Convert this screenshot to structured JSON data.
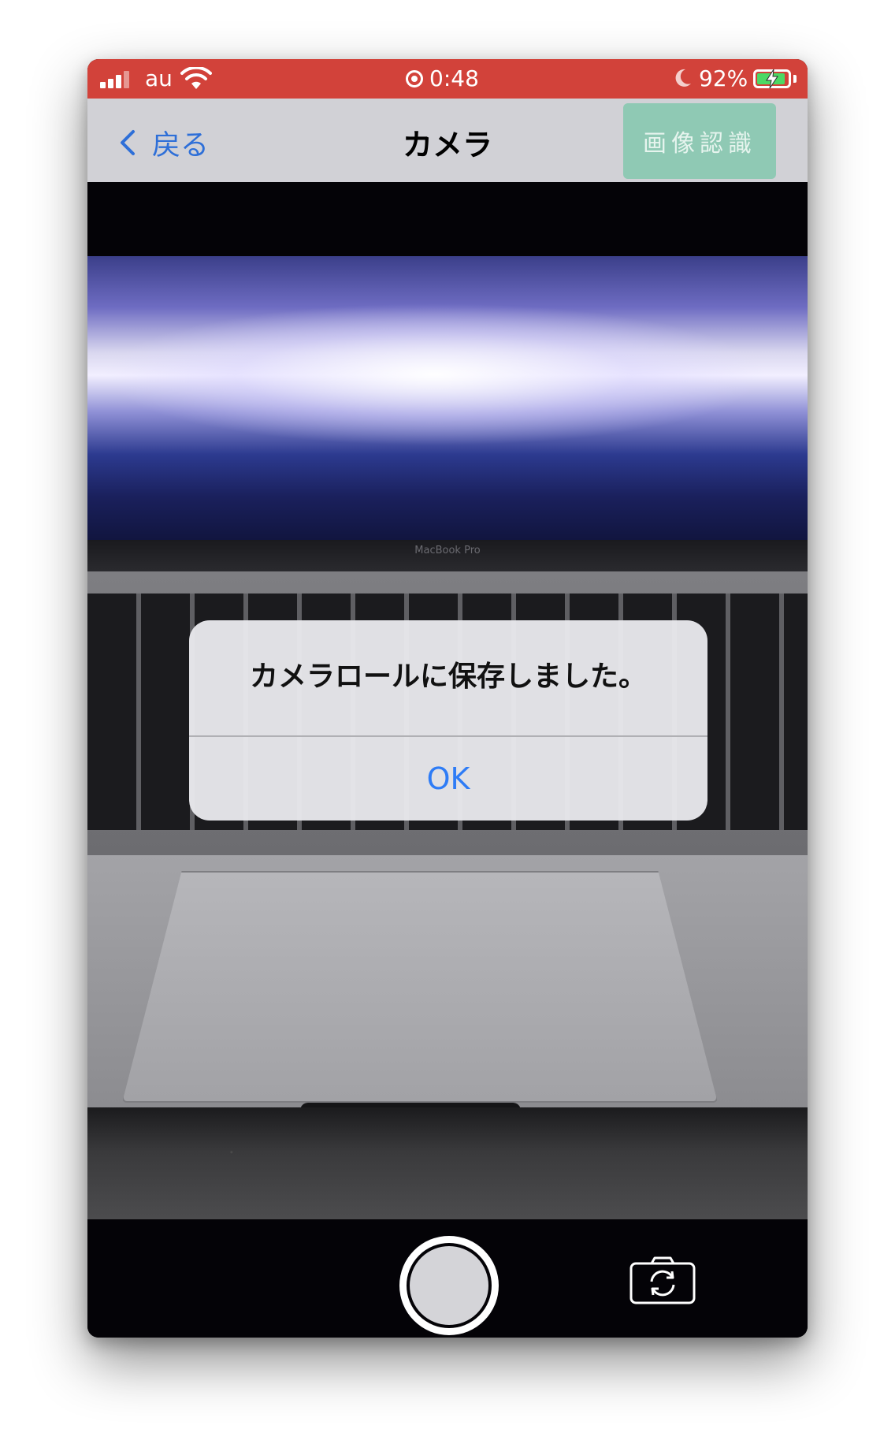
{
  "status_bar": {
    "carrier": "au",
    "time": "0:48",
    "battery_percent": "92%",
    "battery_level": 0.92,
    "background_color": "#d2423a"
  },
  "nav": {
    "back_label": "戻る",
    "title": "カメラ",
    "recognize_label": "画像認識"
  },
  "preview": {
    "bezel_label": "MacBook Pro"
  },
  "alert": {
    "message": "カメラロールに保存しました。",
    "ok_label": "OK"
  },
  "colors": {
    "accent_blue": "#2e6fd8",
    "recognize_button": "#8fc9b4",
    "battery_green": "#4cd964"
  },
  "icons": {
    "back": "chevron-left-icon",
    "flip": "camera-flip-icon",
    "shutter": "shutter-button"
  }
}
